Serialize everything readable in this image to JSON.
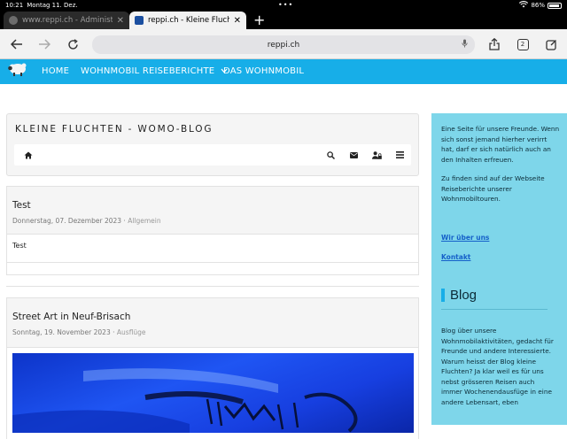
{
  "status": {
    "time": "10:21",
    "date": "Montag 11. Dez.",
    "battery": "86%"
  },
  "tabs": [
    {
      "title": "www.reppi.ch - Administ",
      "favicon_color": "#7a7a7a"
    },
    {
      "title": "reppi.ch - Kleine Fluchten",
      "favicon_color": "#1b4fa0"
    }
  ],
  "toolbar": {
    "address": "reppi.ch",
    "tab_count": "2"
  },
  "nav": {
    "items": [
      "HOME",
      "WOHNMOBIL REISEBERICHTE",
      "DAS WOHNMOBIL"
    ],
    "dropdown_indicator": "chevron-down-icon"
  },
  "blog": {
    "title": "KLEINE FLUCHTEN - WOMO-BLOG",
    "icons": [
      "home-icon",
      "search-icon",
      "envelope-icon",
      "user-lock-icon",
      "menu-icon"
    ]
  },
  "posts": [
    {
      "title": "Test",
      "date": "Donnerstag, 07. Dezember 2023",
      "category": "Allgemein",
      "body": "Test"
    },
    {
      "title": "Street Art in Neuf-Brisach",
      "date": "Sonntag, 19. November 2023",
      "category": "Ausflüge"
    }
  ],
  "meta_separator": "·",
  "sidebar": {
    "intro": "Eine Seite für unsere Freunde. Wenn sich sonst jemand hierher verirrt hat, darf er sich natürlich auch an den Inhalten erfreuen.",
    "info": "Zu finden sind auf der Webseite Reiseberichte unserer Wohnmobiltouren.",
    "link_about": "Wir über uns",
    "link_contact": "Kontakt",
    "blog_heading": "Blog",
    "blog_text": "Blog über unsere Wohnmobilaktivitäten, gedacht für Freunde und andere Interessierte. Warum heisst der Blog kleine Fluchten? Ja klar weil es für uns nebst grösseren Reisen auch immer Wochenendausfüge in eine andere Lebensart, eben"
  },
  "colors": {
    "nav_bg": "#17aee8",
    "sidebar_bg": "#7ed6ea",
    "link": "#1560c9"
  }
}
